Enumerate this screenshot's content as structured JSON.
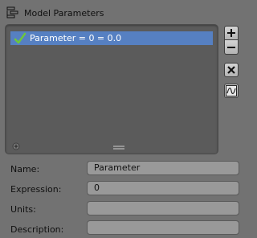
{
  "panel": {
    "title": "Model Parameters",
    "title_icon": "parameters-panel-icon"
  },
  "list": {
    "items": [
      {
        "label": "Parameter = 0 = 0.0",
        "checked": true,
        "selected": true
      }
    ]
  },
  "side_buttons": [
    "plus-icon",
    "minus-icon",
    "close-x-icon",
    "curve-graph-icon"
  ],
  "form": {
    "name_label": "Name:",
    "name_value": "Parameter",
    "expression_label": "Expression:",
    "expression_value": "0",
    "units_label": "Units:",
    "units_value": "",
    "description_label": "Description:",
    "description_value": ""
  },
  "colors": {
    "background": "#727272",
    "list_background": "#5b5b5b",
    "selection": "#5680c2",
    "field": "#999999",
    "check": "#6ec63c"
  }
}
